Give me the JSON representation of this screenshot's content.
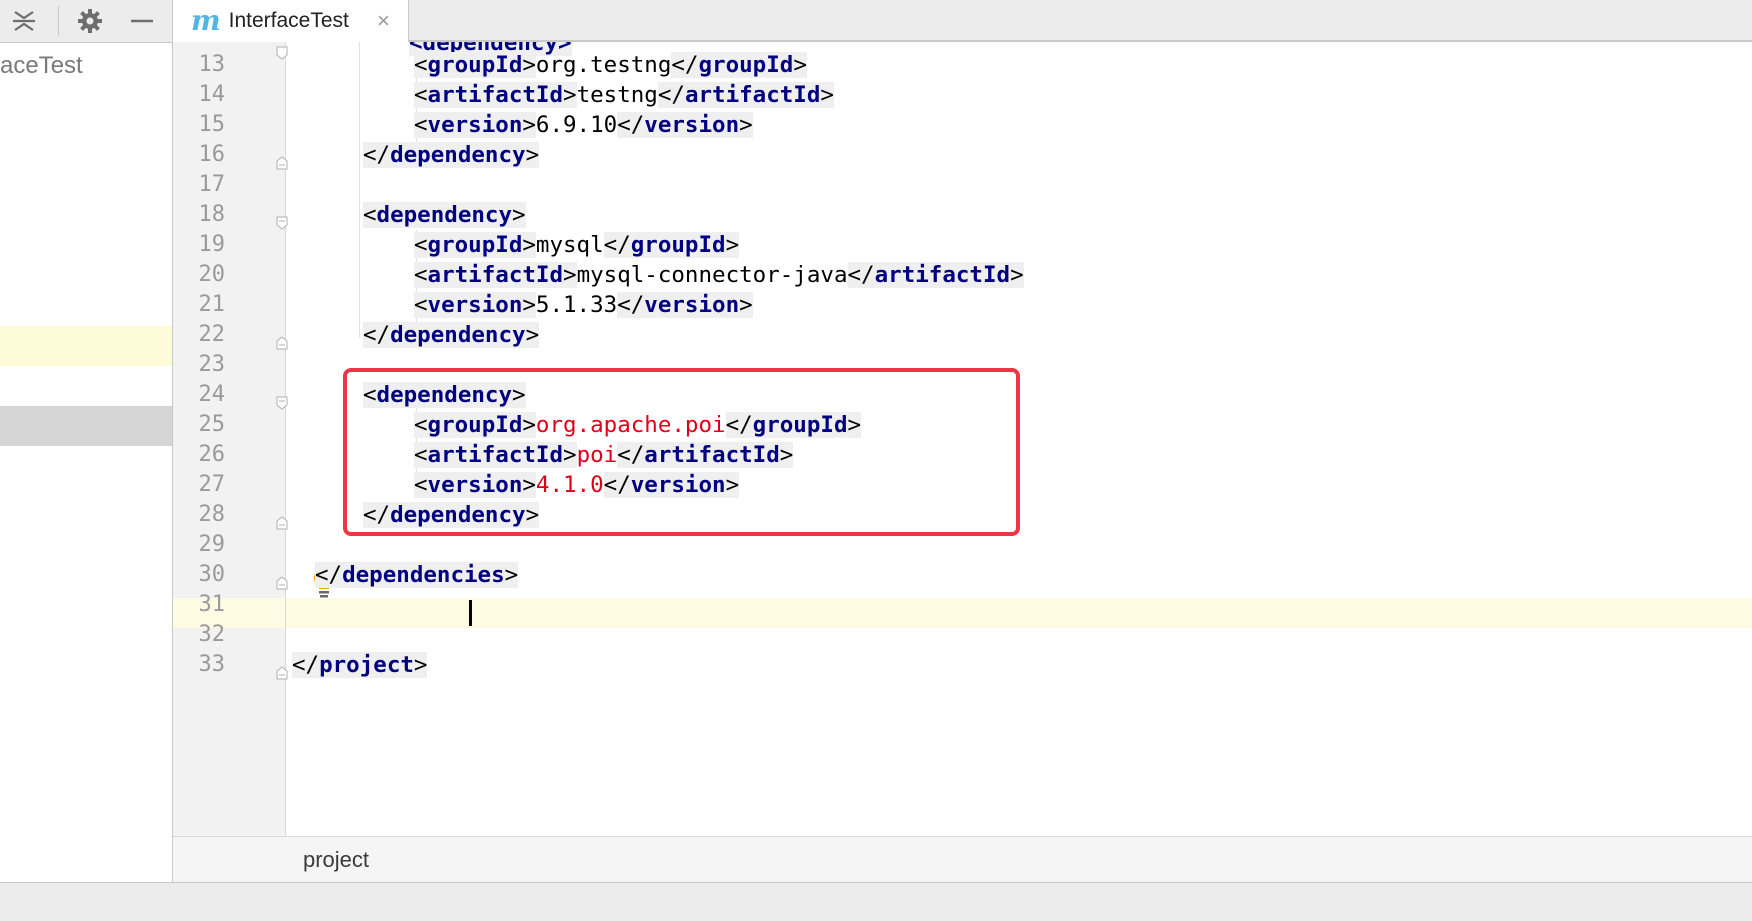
{
  "left_panel": {
    "project_label": "aceTest"
  },
  "tab": {
    "icon_letter": "m",
    "title": "InterfaceTest",
    "close_glyph": "×"
  },
  "editor": {
    "line_numbers": [
      "13",
      "14",
      "15",
      "16",
      "17",
      "18",
      "19",
      "20",
      "21",
      "22",
      "23",
      "24",
      "25",
      "26",
      "27",
      "28",
      "29",
      "30",
      "31",
      "32",
      "33"
    ],
    "current_line": "31"
  },
  "breadcrumb": {
    "item": "project"
  },
  "colors": {
    "tag_name": "#000080",
    "highlighted_value": "#e0001a",
    "annotation_box": "#ee3543",
    "current_line_bg": "#fefbe3"
  },
  "icons": [
    "collapse-all-icon",
    "gear-icon",
    "minimize-icon",
    "maven-icon",
    "close-icon",
    "fold-marker-icon",
    "lightbulb-icon"
  ],
  "code": {
    "partial_top": "<dependency>",
    "l13": {
      "open": "groupId",
      "value": "org.testng",
      "close": "groupId"
    },
    "l14": {
      "open": "artifactId",
      "value": "testng",
      "close": "artifactId"
    },
    "l15": {
      "open": "version",
      "value": "6.9.10",
      "close": "version"
    },
    "l16": {
      "close": "dependency"
    },
    "l18": {
      "open": "dependency"
    },
    "l19": {
      "open": "groupId",
      "value": "mysql",
      "close": "groupId"
    },
    "l20": {
      "open": "artifactId",
      "value": "mysql-connector-java",
      "close": "artifactId"
    },
    "l21": {
      "open": "version",
      "value": "5.1.33",
      "close": "version"
    },
    "l22": {
      "close": "dependency"
    },
    "l24": {
      "open": "dependency"
    },
    "l25": {
      "open": "groupId",
      "value": "org.apache.poi",
      "close": "groupId"
    },
    "l26": {
      "open": "artifactId",
      "value": "poi",
      "close": "artifactId"
    },
    "l27": {
      "open": "version",
      "value": "4.1.0",
      "close": "version"
    },
    "l28": {
      "close": "dependency"
    },
    "l30": {
      "close": "dependencies"
    },
    "l33": {
      "close": "project"
    }
  }
}
